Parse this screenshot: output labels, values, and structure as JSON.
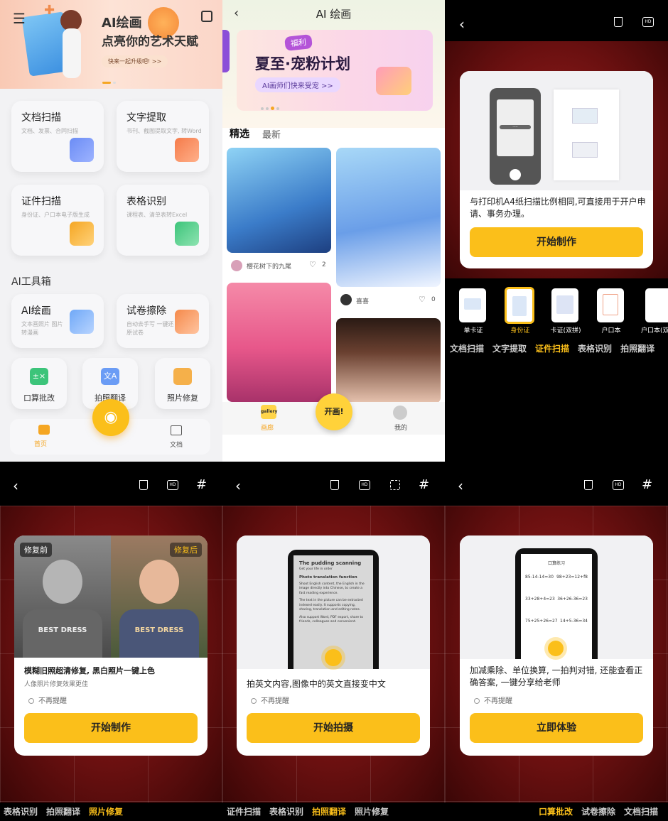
{
  "panel1": {
    "title": "AI绘画",
    "subtitle": "点亮你的艺术天赋",
    "banner_button": "快来一起升级吧! >>",
    "tiles": [
      {
        "title": "文档扫描",
        "sub": "文档、发票、合同扫描"
      },
      {
        "title": "文字提取",
        "sub": "书刊、截图提取文字, 转Word"
      },
      {
        "title": "证件扫描",
        "sub": "身份证、户口本电子版生成"
      },
      {
        "title": "表格识别",
        "sub": "课程表、清单表转Excel"
      }
    ],
    "section": "AI工具箱",
    "tools": [
      {
        "title": "AI绘画",
        "sub": "文本画照片 图片转漫画"
      },
      {
        "title": "试卷擦除",
        "sub": "自动去手写 一键还原试卷"
      }
    ],
    "small": [
      "口算批改",
      "拍照翻译",
      "照片修复"
    ],
    "nav": [
      "首页",
      "文档"
    ]
  },
  "panel2": {
    "title": "AI 绘画",
    "banner_tag": "福利",
    "banner_title": "夏至·宠粉计划",
    "banner_btn": "AI画师们快来受宠 >>",
    "tabs": [
      "精选",
      "最新"
    ],
    "cards": [
      {
        "user": "樱花树下的九尾",
        "likes": "2"
      },
      {
        "user": "喜喜",
        "likes": "0"
      }
    ],
    "nav": [
      "画廊",
      "开画!",
      "我的"
    ],
    "gallery_badge": "gallery"
  },
  "panel3": {
    "desc": "与打印机A4纸扫描比例相同,可直接用于开户申请、事务办理。",
    "button": "开始制作",
    "options": [
      "单卡证",
      "身份证",
      "卡证(双拼)",
      "户口本",
      "户口本(双"
    ],
    "tabs": [
      "文档扫描",
      "文字提取",
      "证件扫描",
      "表格识别",
      "拍照翻译"
    ],
    "phone_pill": "-----"
  },
  "panel4": {
    "before": "修复前",
    "after": "修复后",
    "title": "模糊旧照超清修复, 黑白照片一键上色",
    "sub": "人像照片修复效果更佳",
    "remind": "不再提醒",
    "button": "开始制作",
    "tabs": [
      "表格识别",
      "拍照翻译",
      "照片修复"
    ],
    "shirt_text": "BEST DRESS"
  },
  "panel5": {
    "doc_title": "The pudding scanning",
    "doc_sub": "Get your life in order",
    "doc_h2": "Photo translation function",
    "doc_p1": "Shoot English content, the English in the image directly into Chinese, to create a fast reading experience.",
    "doc_p2": "The text in the picture can be extracted indexed easily. It supports copying, sharing, translation and editing notes.",
    "doc_p3": "Also support Word, PDF export, share to friends, colleagues and convenient.",
    "desc": "拍英文内容,图像中的英文直接变中文",
    "remind": "不再提醒",
    "button": "开始拍摄",
    "tabs": [
      "证件扫描",
      "表格识别",
      "拍照翻译",
      "照片修复"
    ]
  },
  "panel6": {
    "sheet_title": "口算练习",
    "rows": [
      [
        "85-14-14=30",
        "98+23=12+f8"
      ],
      [
        "33+28+4=23",
        "36+26-36=23"
      ],
      [
        "75+25+26=27",
        "14+5-36=34"
      ]
    ],
    "desc": "加减乘除、单位换算, 一拍判对错, 还能查看正确答案, 一键分享给老师",
    "remind": "不再提醒",
    "button": "立即体验",
    "tabs": [
      "口算批改",
      "试卷擦除",
      "文档扫描"
    ]
  },
  "colors": {
    "accent": "#fbbf1a",
    "dark_red": "#7a1414"
  }
}
